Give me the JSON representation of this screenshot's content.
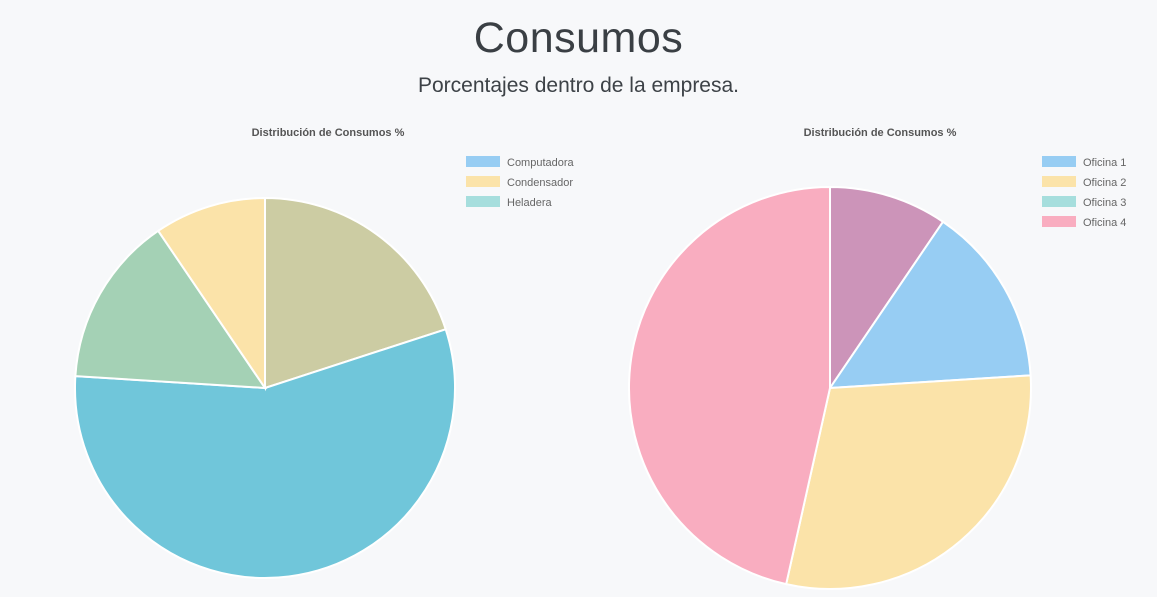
{
  "header": {
    "title": "Consumos",
    "subtitle": "Porcentajes dentro de la empresa."
  },
  "chart_data": [
    {
      "type": "pie",
      "title": "Distribución de Consumos %",
      "legend_position": "top-right",
      "legend": [
        {
          "label": "Computadora",
          "color": "#97cdf3"
        },
        {
          "label": "Condensador",
          "color": "#fbe3a9"
        },
        {
          "label": "Heladera",
          "color": "#a6dedd"
        }
      ],
      "slices": [
        {
          "value": 20,
          "color": "#cccca3"
        },
        {
          "value": 56,
          "color": "#70c6da"
        },
        {
          "value": 14.5,
          "color": "#a4d1b5"
        },
        {
          "value": 9.5,
          "color": "#fbe3a9"
        }
      ]
    },
    {
      "type": "pie",
      "title": "Distribución de Consumos %",
      "legend_position": "top-right",
      "legend": [
        {
          "label": "Oficina 1",
          "color": "#97cdf3"
        },
        {
          "label": "Oficina 2",
          "color": "#fbe3a9"
        },
        {
          "label": "Oficina 3",
          "color": "#a6dedd"
        },
        {
          "label": "Oficina 4",
          "color": "#f9adc0"
        }
      ],
      "slices": [
        {
          "value": 9.5,
          "color": "#cc94b9"
        },
        {
          "value": 14.5,
          "color": "#97cdf3"
        },
        {
          "value": 29.5,
          "color": "#fbe3a9"
        },
        {
          "value": 46.5,
          "color": "#f9adc0"
        }
      ]
    }
  ]
}
